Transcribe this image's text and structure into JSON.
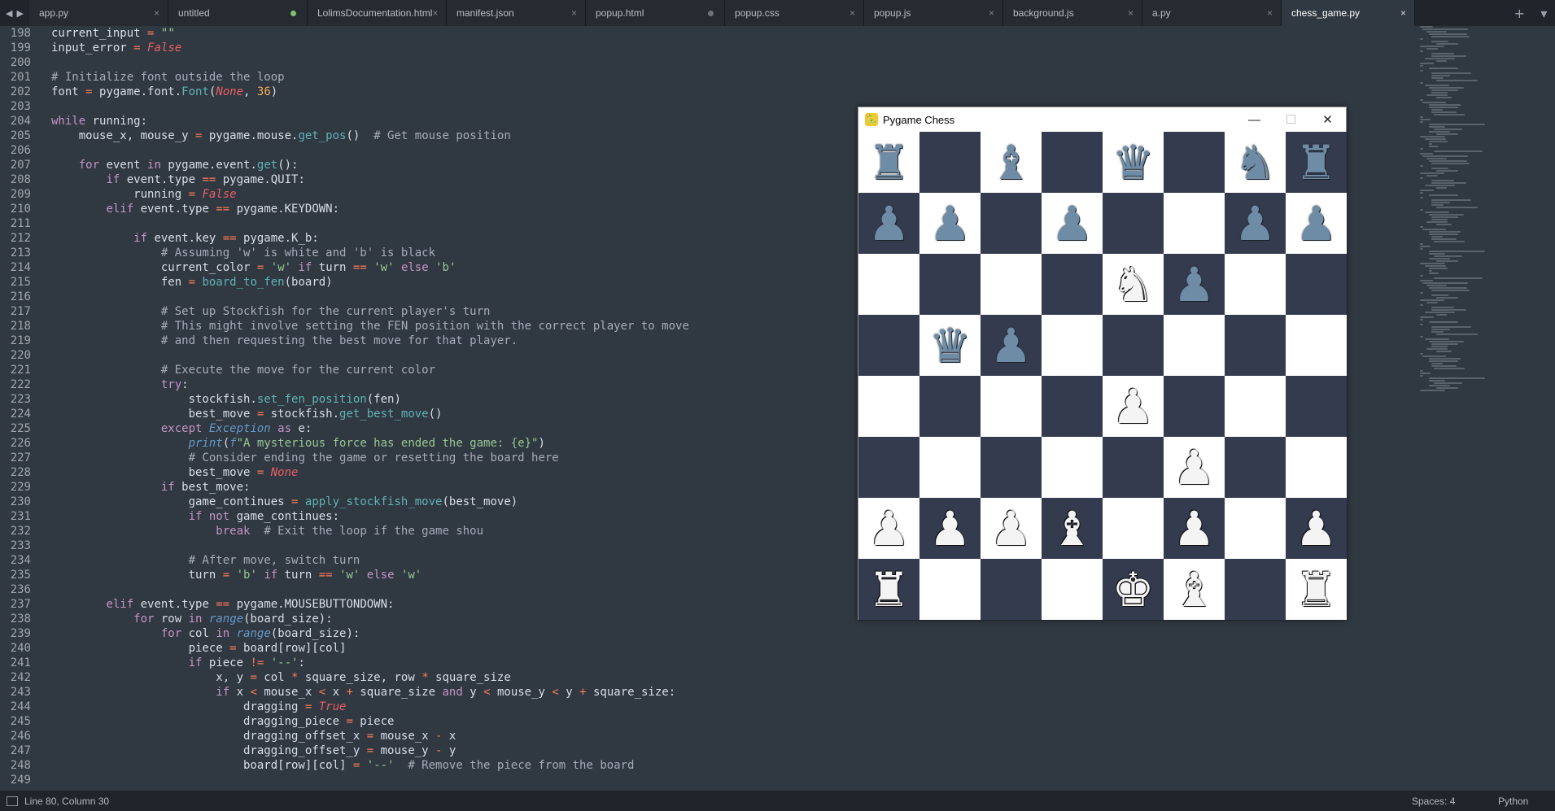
{
  "tabs": [
    {
      "label": "app.py",
      "state": "close"
    },
    {
      "label": "untitled",
      "state": "dirty"
    },
    {
      "label": "LolimsDocumentation.html",
      "state": "close"
    },
    {
      "label": "manifest.json",
      "state": "close"
    },
    {
      "label": "popup.html",
      "state": "dirty"
    },
    {
      "label": "popup.css",
      "state": "close"
    },
    {
      "label": "popup.js",
      "state": "close"
    },
    {
      "label": "background.js",
      "state": "close"
    },
    {
      "label": "a.py",
      "state": "close"
    },
    {
      "label": "chess_game.py",
      "state": "active"
    }
  ],
  "icons": {
    "nav_back": "◀",
    "nav_forward": "▶",
    "tab_close": "×",
    "new_tab": "+",
    "tab_menu": "▾"
  },
  "code_lines": [
    {
      "n": "198",
      "t": "current_input = \"\""
    },
    {
      "n": "199",
      "t": "input_error = False"
    },
    {
      "n": "200",
      "t": ""
    },
    {
      "n": "201",
      "t": "# Initialize font outside the loop"
    },
    {
      "n": "202",
      "t": "font = pygame.font.Font(None, 36)"
    },
    {
      "n": "203",
      "t": ""
    },
    {
      "n": "204",
      "t": "while running:"
    },
    {
      "n": "205",
      "t": "    mouse_x, mouse_y = pygame.mouse.get_pos()  # Get mouse position"
    },
    {
      "n": "206",
      "t": ""
    },
    {
      "n": "207",
      "t": "    for event in pygame.event.get():"
    },
    {
      "n": "208",
      "t": "        if event.type == pygame.QUIT:"
    },
    {
      "n": "209",
      "t": "            running = False"
    },
    {
      "n": "210",
      "t": "        elif event.type == pygame.KEYDOWN:"
    },
    {
      "n": "211",
      "t": ""
    },
    {
      "n": "212",
      "t": "            if event.key == pygame.K_b:"
    },
    {
      "n": "213",
      "t": "                # Assuming 'w' is white and 'b' is black"
    },
    {
      "n": "214",
      "t": "                current_color = 'w' if turn == 'w' else 'b'"
    },
    {
      "n": "215",
      "t": "                fen = board_to_fen(board)"
    },
    {
      "n": "216",
      "t": ""
    },
    {
      "n": "217",
      "t": "                # Set up Stockfish for the current player's turn"
    },
    {
      "n": "218",
      "t": "                # This might involve setting the FEN position with the correct player to move"
    },
    {
      "n": "219",
      "t": "                # and then requesting the best move for that player."
    },
    {
      "n": "220",
      "t": ""
    },
    {
      "n": "221",
      "t": "                # Execute the move for the current color"
    },
    {
      "n": "222",
      "t": "                try:"
    },
    {
      "n": "223",
      "t": "                    stockfish.set_fen_position(fen)"
    },
    {
      "n": "224",
      "t": "                    best_move = stockfish.get_best_move()"
    },
    {
      "n": "225",
      "t": "                except Exception as e:"
    },
    {
      "n": "226",
      "t": "                    print(f\"A mysterious force has ended the game: {e}\")"
    },
    {
      "n": "227",
      "t": "                    # Consider ending the game or resetting the board here"
    },
    {
      "n": "228",
      "t": "                    best_move = None"
    },
    {
      "n": "229",
      "t": "                if best_move:"
    },
    {
      "n": "230",
      "t": "                    game_continues = apply_stockfish_move(best_move)"
    },
    {
      "n": "231",
      "t": "                    if not game_continues:"
    },
    {
      "n": "232",
      "t": "                        break  # Exit the loop if the game shou"
    },
    {
      "n": "233",
      "t": ""
    },
    {
      "n": "234",
      "t": "                    # After move, switch turn"
    },
    {
      "n": "235",
      "t": "                    turn = 'b' if turn == 'w' else 'w'"
    },
    {
      "n": "236",
      "t": ""
    },
    {
      "n": "237",
      "t": "        elif event.type == pygame.MOUSEBUTTONDOWN:"
    },
    {
      "n": "238",
      "t": "            for row in range(board_size):"
    },
    {
      "n": "239",
      "t": "                for col in range(board_size):"
    },
    {
      "n": "240",
      "t": "                    piece = board[row][col]"
    },
    {
      "n": "241",
      "t": "                    if piece != '--':"
    },
    {
      "n": "242",
      "t": "                        x, y = col * square_size, row * square_size"
    },
    {
      "n": "243",
      "t": "                        if x < mouse_x < x + square_size and y < mouse_y < y + square_size:"
    },
    {
      "n": "244",
      "t": "                            dragging = True"
    },
    {
      "n": "245",
      "t": "                            dragging_piece = piece"
    },
    {
      "n": "246",
      "t": "                            dragging_offset_x = mouse_x - x"
    },
    {
      "n": "247",
      "t": "                            dragging_offset_y = mouse_y - y"
    },
    {
      "n": "248",
      "t": "                            board[row][col] = '--'  # Remove the piece from the board"
    },
    {
      "n": "249",
      "t": ""
    }
  ],
  "status": {
    "position": "Line 80, Column 30",
    "spaces": "Spaces: 4",
    "syntax": "Python"
  },
  "chess_window": {
    "title": "Pygame Chess",
    "minimize": "—",
    "maximize": "☐",
    "close": "✕",
    "board": [
      [
        "bR",
        "--",
        "bB",
        "--",
        "bQ",
        "--",
        "bN",
        "bR"
      ],
      [
        "bP",
        "bP",
        "--",
        "bP",
        "--",
        "--",
        "bP",
        "bP"
      ],
      [
        "--",
        "--",
        "--",
        "--",
        "wN",
        "bP",
        "--",
        "--"
      ],
      [
        "--",
        "bQ",
        "bP",
        "--",
        "--",
        "--",
        "--",
        "--"
      ],
      [
        "--",
        "--",
        "--",
        "--",
        "wP",
        "--",
        "--",
        "--"
      ],
      [
        "--",
        "--",
        "--",
        "--",
        "--",
        "wP",
        "--",
        "--"
      ],
      [
        "wP",
        "wP",
        "wP",
        "wB",
        "--",
        "wP",
        "--",
        "wP"
      ],
      [
        "wR",
        "--",
        "--",
        "--",
        "wK",
        "wB",
        "--",
        "wR"
      ]
    ],
    "colors": {
      "light": "#ffffff",
      "dark": "#353b4f",
      "black_piece": "#6f8ca6",
      "white_piece": "#f4f4f4"
    }
  },
  "theme": {
    "background": "#303841",
    "tabbar": "#1f252b"
  }
}
